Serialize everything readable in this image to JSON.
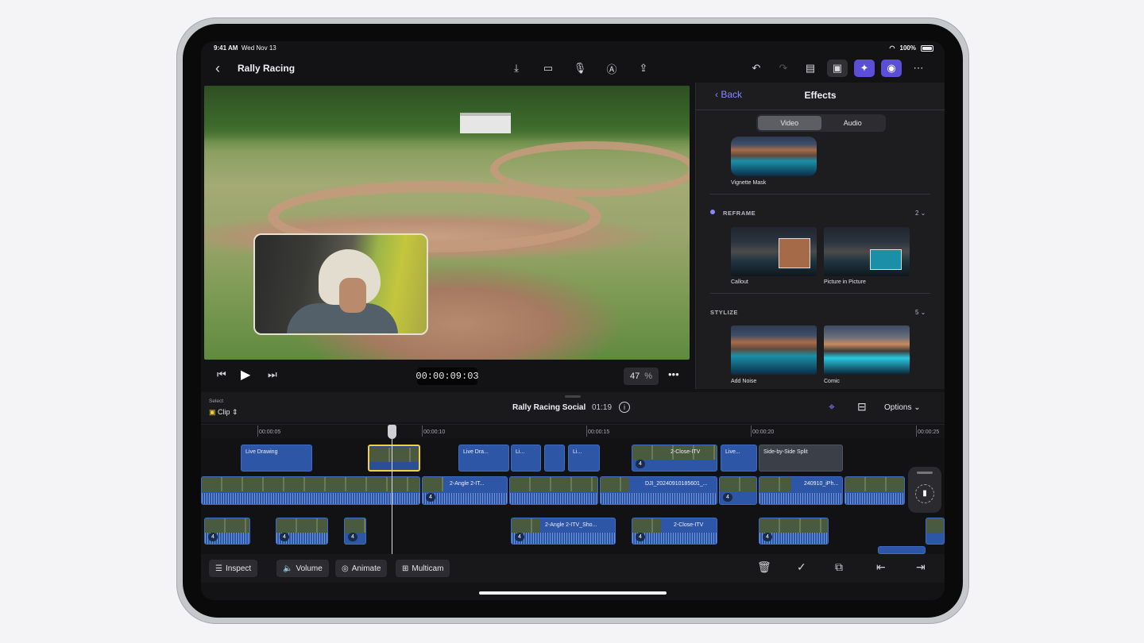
{
  "status": {
    "time": "9:41 AM",
    "date": "Wed Nov 13",
    "battery": "100%"
  },
  "nav": {
    "title": "Rally Racing",
    "back_icon": "chevron-left-icon"
  },
  "viewer": {
    "timecode": "00:00:09:03",
    "zoom": "47",
    "zoom_unit": "%"
  },
  "effects": {
    "back": "Back",
    "title": "Effects",
    "tabs": [
      "Video",
      "Audio"
    ],
    "selected_tab": "Video",
    "top_item": "Vignette Mask",
    "sections": [
      {
        "name": "REFRAME",
        "count": "2",
        "items": [
          "Callout",
          "Picture in Picture"
        ]
      },
      {
        "name": "STYLIZE",
        "count": "5",
        "items": [
          "Add Noise",
          "Comic"
        ]
      }
    ]
  },
  "timeline": {
    "select_label": "Select",
    "select_value": "Clip",
    "project": "Rally Racing Social",
    "duration": "01:19",
    "options": "Options",
    "ruler": [
      "00:00:05",
      "00:00:10",
      "00:00:15",
      "00:00:20",
      "00:00:25"
    ],
    "top_clips": [
      "Live Drawing",
      "Live Dra...",
      "Li...",
      "Li...",
      "2-Close-ITV",
      "Live...",
      "Side-by-Side Split"
    ],
    "main_clips": [
      "2-Angle 2-IT...",
      "DJI_20240910185601_...",
      "240910_iPh..."
    ],
    "low_clips": [
      "2-Angle 2-ITV_Sho...",
      "2-Close-ITV"
    ],
    "badge": "4"
  },
  "toolbar": {
    "inspect": "Inspect",
    "volume": "Volume",
    "animate": "Animate",
    "multicam": "Multicam"
  },
  "colors": {
    "accent": "#5b4fd8",
    "clip_blue": "#2d56a6",
    "selected_clip": "#f0d13a"
  }
}
